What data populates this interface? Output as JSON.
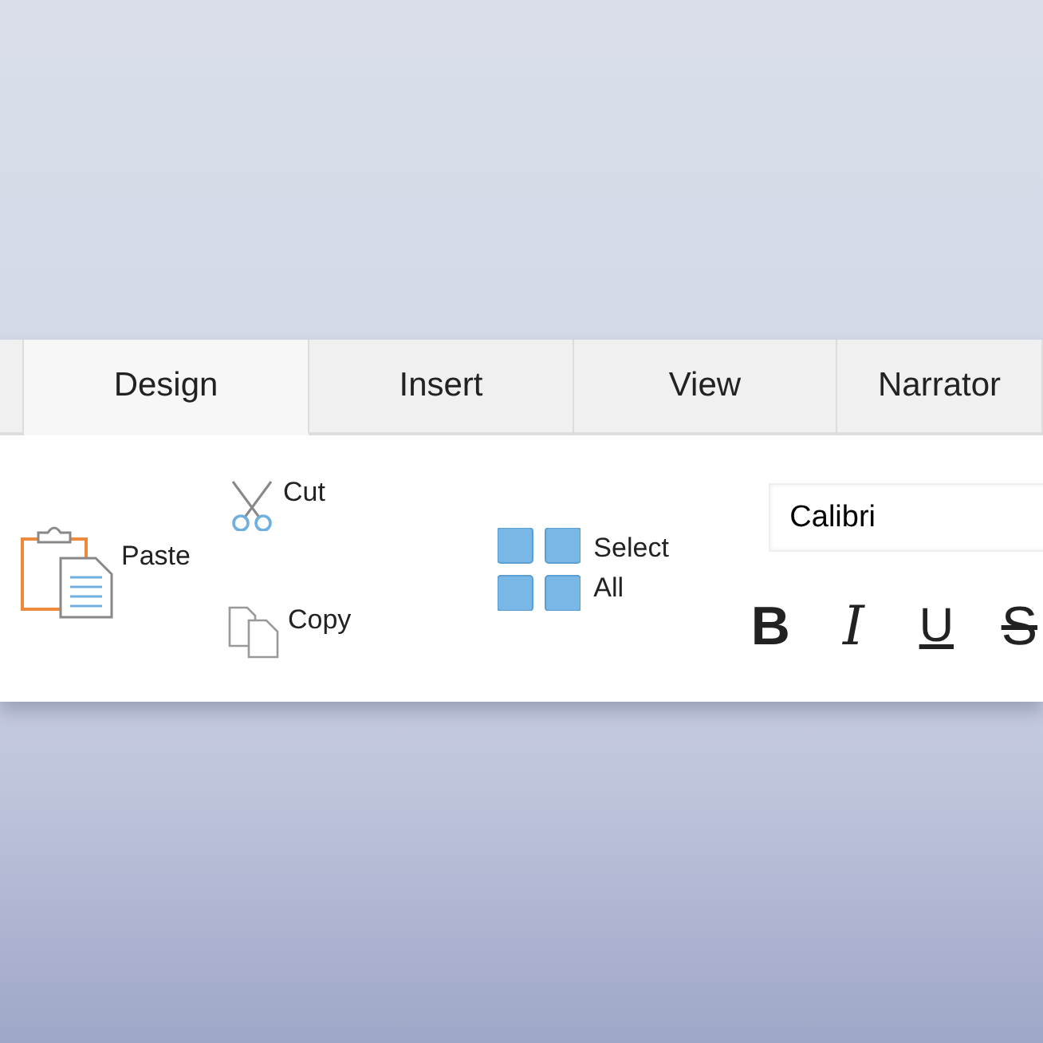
{
  "tabs": [
    {
      "label": "Design",
      "selected": true
    },
    {
      "label": "Insert",
      "selected": false
    },
    {
      "label": "View",
      "selected": false
    },
    {
      "label": "Narrator",
      "selected": false
    }
  ],
  "clipboard": {
    "paste": "Paste",
    "cut": "Cut",
    "copy": "Copy"
  },
  "select_all": "Select All",
  "font": {
    "value": "Calibri"
  },
  "format_buttons": [
    {
      "label": "B",
      "kind": "bold"
    },
    {
      "label": "I",
      "kind": "italic"
    },
    {
      "label": "U",
      "kind": "underline"
    },
    {
      "label": "S",
      "kind": "strike"
    }
  ]
}
